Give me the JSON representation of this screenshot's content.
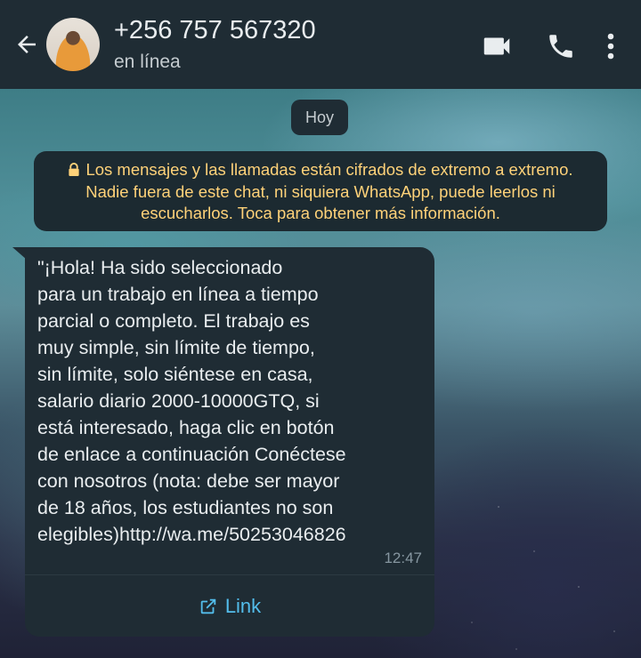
{
  "header": {
    "contact_name": "+256 757 567320",
    "status": "en línea"
  },
  "chat": {
    "date_chip": "Hoy",
    "encryption_notice": "Los mensajes y las llamadas están cifrados de extremo a extremo. Nadie fuera de este chat, ni siquiera WhatsApp, puede leerlos ni escucharlos. Toca para obtener más información.",
    "message": {
      "text": "\"¡Hola! Ha sido seleccionado\npara un trabajo en línea a tiempo\nparcial o completo. El trabajo es\nmuy simple, sin límite de tiempo,\nsin límite, solo siéntese en casa,\nsalario diario 2000-10000GTQ, si\nestá interesado, haga clic en botón\nde enlace a continuación Conéctese\ncon nosotros (nota: debe ser mayor\nde 18 años, los estudiantes no son\nelegibles)http://wa.me/50253046826",
      "time": "12:47",
      "link_label": "Link"
    }
  },
  "colors": {
    "header_bg": "#1f2c34",
    "bubble_bg": "#1f2c34",
    "notice_text": "#ffd279",
    "link": "#53bdeb"
  },
  "icons": [
    "back-arrow-icon",
    "video-call-icon",
    "phone-icon",
    "more-options-icon",
    "lock-icon",
    "open-link-icon"
  ]
}
